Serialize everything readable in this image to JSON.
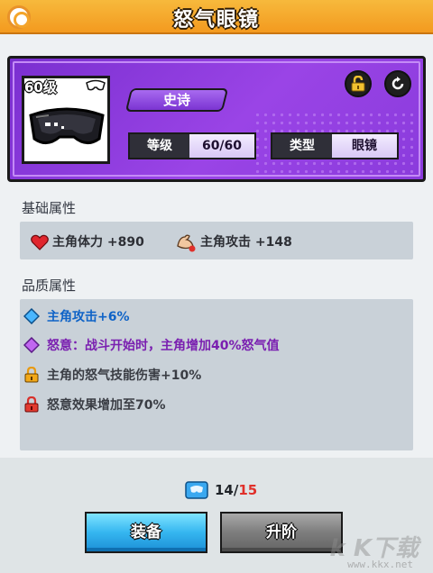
{
  "header": {
    "title": "怒气眼镜"
  },
  "item": {
    "level_badge": "60级",
    "rarity": "史诗",
    "level_label": "等级",
    "level_value": "60/60",
    "type_label": "类型",
    "type_value": "眼镜",
    "rarity_color": "#8a3bdc"
  },
  "base_section": {
    "title": "基础属性",
    "stats": [
      {
        "icon": "heart-icon",
        "text": "主角体力 +890"
      },
      {
        "icon": "muscle-arm-icon",
        "text": "主角攻击 +148"
      }
    ]
  },
  "quality_section": {
    "title": "品质属性",
    "rows": [
      {
        "icon": "blue-diamond-icon",
        "text": "主角攻击+6%",
        "color": "#0f63c7"
      },
      {
        "icon": "purple-diamond-icon",
        "text": "怒意：战斗开始时，主角增加40%怒气值",
        "color": "#7a1fb0"
      },
      {
        "icon": "orange-lock-icon",
        "text": "主角的怒气技能伤害+10%",
        "color": "#3a3d44"
      },
      {
        "icon": "red-lock-icon",
        "text": "怒意效果增加至70%",
        "color": "#3a3d44"
      }
    ]
  },
  "cost": {
    "have": "14",
    "separator": "/",
    "need": "15"
  },
  "buttons": {
    "equip": "装备",
    "upgrade": "升阶"
  },
  "watermark": {
    "text": "k K下载",
    "url": "www.kkx.net"
  }
}
